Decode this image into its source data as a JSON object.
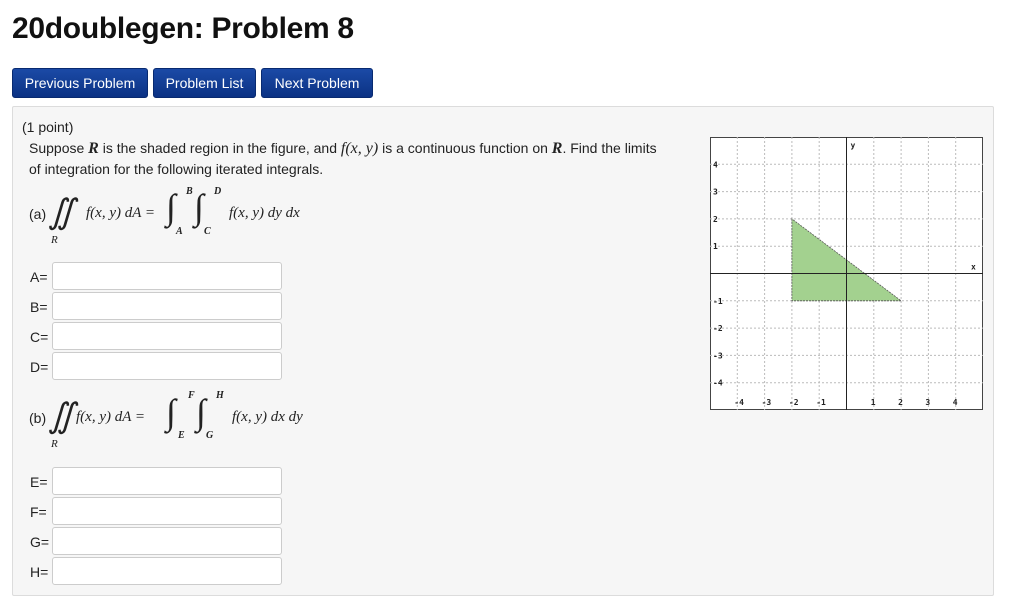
{
  "page": {
    "title": "20doublegen: Problem 8"
  },
  "nav": {
    "previous": "Previous Problem",
    "list": "Problem List",
    "next": "Next Problem",
    "color": "#0e3a93"
  },
  "problem": {
    "points": "(1 point)",
    "statement_a": "Suppose ",
    "R": "R",
    "statement_b": " is the shaded region in the figure, and ",
    "fxy": "f(x, y)",
    "statement_c": " is a continuous function on ",
    "statement_d": ". Find the limits of integration for the following iterated integrals.",
    "part_a": {
      "label": "(a)",
      "lhs": "f(x, y) dA =",
      "region": "R",
      "outer_upper": "B",
      "outer_lower": "A",
      "inner_upper": "D",
      "inner_lower": "C",
      "rhs": "f(x, y) dy dx",
      "fields": [
        {
          "label": "A=",
          "value": ""
        },
        {
          "label": "B=",
          "value": ""
        },
        {
          "label": "C=",
          "value": ""
        },
        {
          "label": "D=",
          "value": ""
        }
      ]
    },
    "part_b": {
      "label": "(b)",
      "lhs": "f(x, y) dA =",
      "region": "R",
      "outer_upper": "F",
      "outer_lower": "E",
      "inner_upper": "H",
      "inner_lower": "G",
      "rhs": "f(x, y) dx dy",
      "fields": [
        {
          "label": "E=",
          "value": ""
        },
        {
          "label": "F=",
          "value": ""
        },
        {
          "label": "G=",
          "value": ""
        },
        {
          "label": "H=",
          "value": ""
        }
      ]
    }
  },
  "graph": {
    "x_axis_label": "x",
    "y_axis_label": "y",
    "x_ticks": [
      "-4",
      "-3",
      "-2",
      "-1",
      "1",
      "2",
      "3",
      "4"
    ],
    "y_ticks": [
      "4",
      "3",
      "2",
      "1",
      "-1",
      "-2",
      "-3",
      "-4"
    ],
    "xlim": [
      -5,
      5
    ],
    "ylim": [
      -5,
      5
    ],
    "region_vertices": [
      [
        -2,
        2
      ],
      [
        -2,
        -1
      ],
      [
        2,
        -1
      ]
    ],
    "region_color": "#a3d18f",
    "grid": true
  }
}
